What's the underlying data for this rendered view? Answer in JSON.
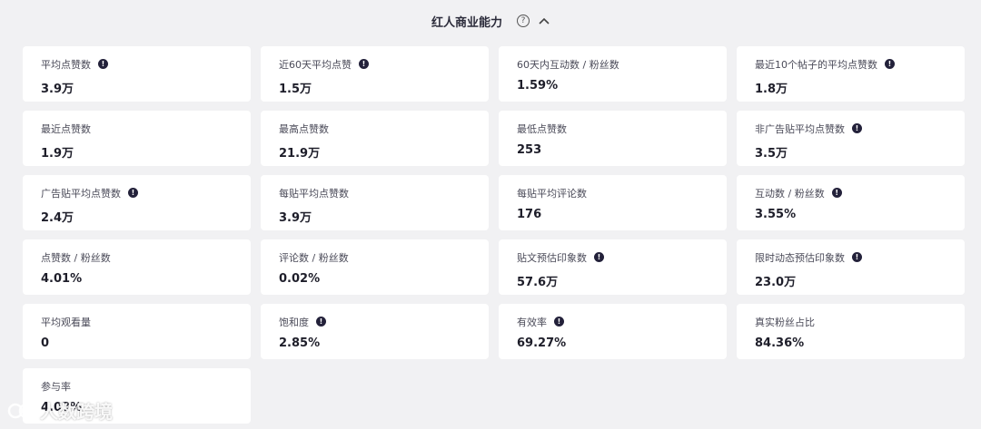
{
  "header": {
    "title": "红人商业能力"
  },
  "metrics": [
    {
      "label": "平均点赞数",
      "value": "3.9万",
      "info": true
    },
    {
      "label": "近60天平均点赞",
      "value": "1.5万",
      "info": true
    },
    {
      "label": "60天内互动数 / 粉丝数",
      "value": "1.59%",
      "info": false
    },
    {
      "label": "最近10个帖子的平均点赞数",
      "value": "1.8万",
      "info": true
    },
    {
      "label": "最近点赞数",
      "value": "1.9万",
      "info": false
    },
    {
      "label": "最高点赞数",
      "value": "21.9万",
      "info": false
    },
    {
      "label": "最低点赞数",
      "value": "253",
      "info": false
    },
    {
      "label": "非广告贴平均点赞数",
      "value": "3.5万",
      "info": true
    },
    {
      "label": "广告贴平均点赞数",
      "value": "2.4万",
      "info": true
    },
    {
      "label": "每贴平均点赞数",
      "value": "3.9万",
      "info": false
    },
    {
      "label": "每贴平均评论数",
      "value": "176",
      "info": false
    },
    {
      "label": "互动数 / 粉丝数",
      "value": "3.55%",
      "info": true
    },
    {
      "label": "点赞数 / 粉丝数",
      "value": "4.01%",
      "info": false
    },
    {
      "label": "评论数 / 粉丝数",
      "value": "0.02%",
      "info": false
    },
    {
      "label": "贴文预估印象数",
      "value": "57.6万",
      "info": true
    },
    {
      "label": "限时动态预估印象数",
      "value": "23.0万",
      "info": true
    },
    {
      "label": "平均观看量",
      "value": "0",
      "info": false
    },
    {
      "label": "饱和度",
      "value": "2.85%",
      "info": true
    },
    {
      "label": "有效率",
      "value": "69.27%",
      "info": true
    },
    {
      "label": "真实粉丝占比",
      "value": "84.36%",
      "info": false
    },
    {
      "label": "参与率",
      "value": "4.03%",
      "info": false
    }
  ],
  "watermark": {
    "text": "人数跨境"
  }
}
